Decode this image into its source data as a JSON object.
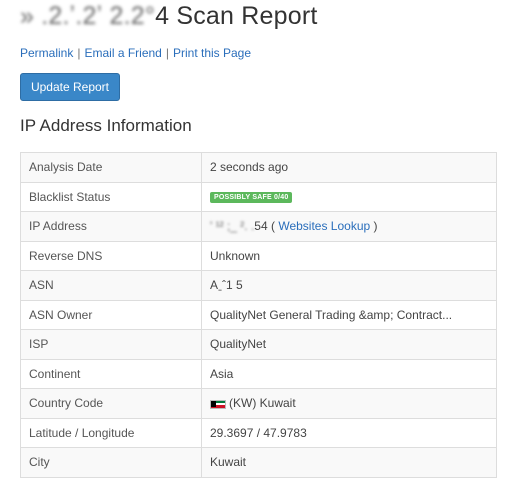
{
  "header": {
    "title_obscured": "» .2.ʼ.2ʼ 2.2°",
    "title_visible": "4 Scan Report"
  },
  "links": {
    "permalink": "Permalink",
    "email": "Email a Friend",
    "print": "Print this Page",
    "separator": "|"
  },
  "update_button": "Update Report",
  "section_title": "IP Address Information",
  "badge": {
    "color": "#5cb85c"
  },
  "flag": {
    "country": "Kuwait",
    "colors": [
      "#007a3d",
      "#ffffff",
      "#ce1126",
      "#000000"
    ]
  },
  "rows": [
    {
      "key": "Analysis Date",
      "value": "2 seconds ago"
    },
    {
      "key": "Blacklist Status",
      "badge": "POSSIBLY SAFE 0/40"
    },
    {
      "key": "IP Address",
      "value_obscured": "' ¹² ;_ ². .",
      "value_tail": "54",
      "link": "Websites Lookup",
      "paren_open": "(",
      "paren_close": ")"
    },
    {
      "key": "Reverse DNS",
      "value": "Unknown"
    },
    {
      "key": "ASN",
      "value": "Aˍˆ1  5"
    },
    {
      "key": "ASN Owner",
      "value": "QualityNet General Trading &amp; Contract..."
    },
    {
      "key": "ISP",
      "value": "QualityNet"
    },
    {
      "key": "Continent",
      "value": "Asia"
    },
    {
      "key": "Country Code",
      "value": "(KW) Kuwait"
    },
    {
      "key": "Latitude / Longitude",
      "value": "29.3697 / 47.9783"
    },
    {
      "key": "City",
      "value": "Kuwait"
    }
  ]
}
